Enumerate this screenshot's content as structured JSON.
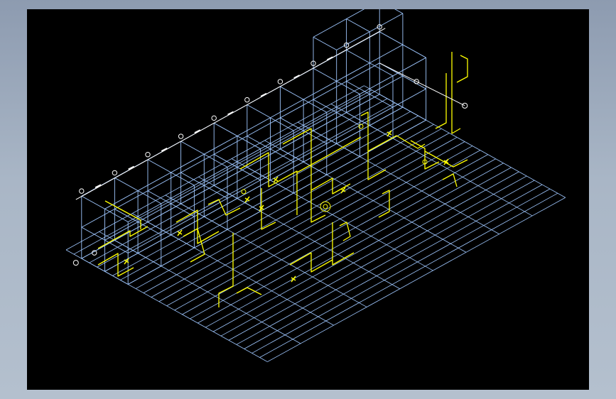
{
  "viewport": {
    "background_color": "#000000",
    "frame_color": "#a9b6c6"
  },
  "drawing": {
    "type": "isometric-piping-drawing",
    "grid_color": "#9fc7ff",
    "piping_color": "#ffff00",
    "bubble_color": "#ffffff"
  }
}
